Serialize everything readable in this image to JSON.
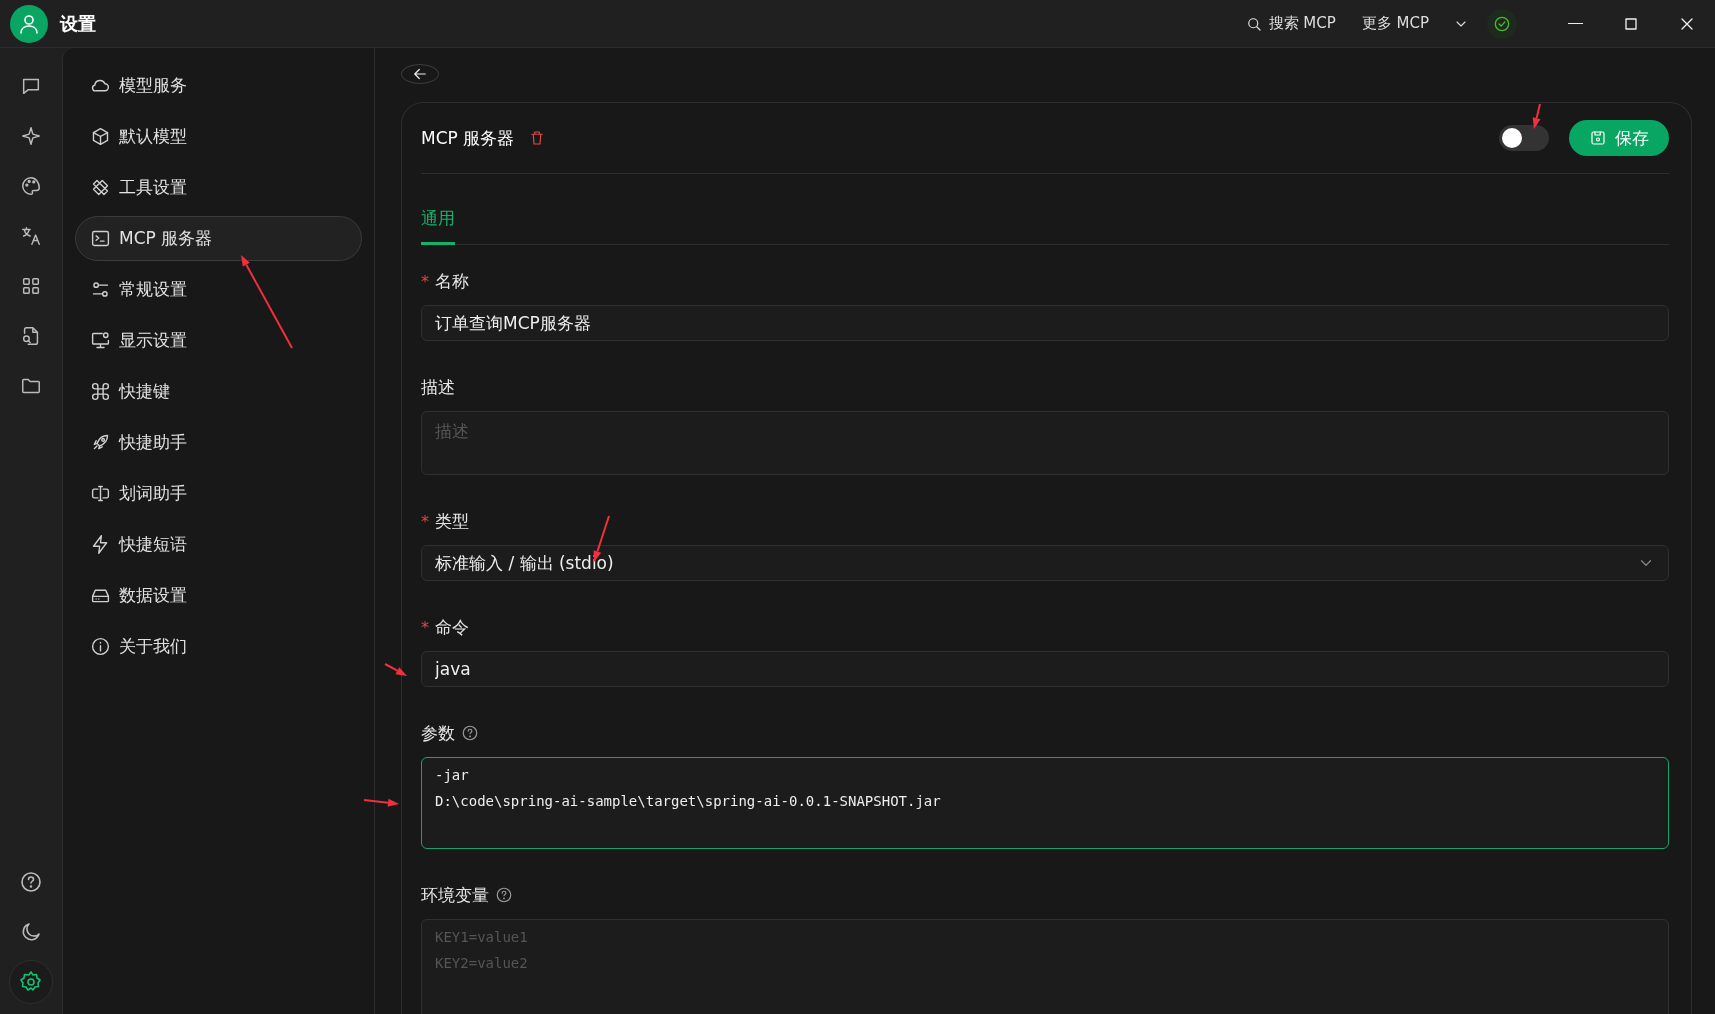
{
  "window": {
    "title": "设置"
  },
  "titlebar": {
    "search": "搜索 MCP",
    "more": "更多 MCP",
    "status_ok": true
  },
  "rail": {
    "items": [
      {
        "kind": "chat",
        "selected": false
      },
      {
        "kind": "sparkle",
        "selected": false
      },
      {
        "kind": "palette",
        "selected": false
      },
      {
        "kind": "translate",
        "selected": false
      },
      {
        "kind": "grid",
        "selected": false
      },
      {
        "kind": "file-search",
        "selected": false
      },
      {
        "kind": "folder",
        "selected": false
      }
    ],
    "bottom": [
      {
        "kind": "help",
        "selected": false
      },
      {
        "kind": "moon",
        "selected": false
      },
      {
        "kind": "settings",
        "selected": true
      }
    ]
  },
  "sidebar": {
    "items": [
      {
        "label": "模型服务",
        "selected": false
      },
      {
        "label": "默认模型",
        "selected": false
      },
      {
        "label": "工具设置",
        "selected": false
      },
      {
        "label": "MCP 服务器",
        "selected": true
      },
      {
        "label": "常规设置",
        "selected": false
      },
      {
        "label": "显示设置",
        "selected": false
      },
      {
        "label": "快捷键",
        "selected": false
      },
      {
        "label": "快捷助手",
        "selected": false
      },
      {
        "label": "划词助手",
        "selected": false
      },
      {
        "label": "快捷短语",
        "selected": false
      },
      {
        "label": "数据设置",
        "selected": false
      },
      {
        "label": "关于我们",
        "selected": false
      }
    ]
  },
  "server": {
    "title": "MCP 服务器",
    "enabled": false,
    "save": "保存",
    "tabs": [
      {
        "label": "通用",
        "selected": true
      }
    ],
    "fields": [
      {
        "kind": "input",
        "required_mark": "*",
        "label": "名称",
        "value": "订单查询MCP服务器"
      },
      {
        "kind": "textarea",
        "label": "描述",
        "placeholder": "描述"
      },
      {
        "kind": "select",
        "required_mark": "*",
        "label": "类型",
        "value": "标准输入 / 输出 (stdio)"
      },
      {
        "kind": "input",
        "required_mark": "*",
        "label": "命令",
        "value": "java"
      },
      {
        "kind": "code",
        "label": "参数",
        "help": true,
        "focused": true,
        "value": "-jar\nD:\\code\\spring-ai-sample\\target\\spring-ai-0.0.1-SNAPSHOT.jar"
      },
      {
        "kind": "code",
        "label": "环境变量",
        "help": true,
        "focused": false,
        "placeholder": "KEY1=value1\nKEY2=value2"
      }
    ]
  }
}
